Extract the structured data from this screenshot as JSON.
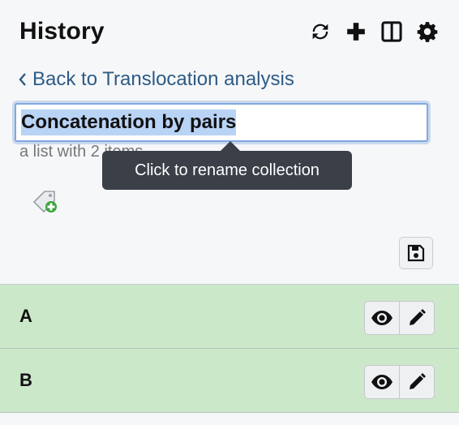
{
  "header": {
    "title": "History"
  },
  "back_link": {
    "label": "Back to Translocation analysis"
  },
  "collection": {
    "name": "Concatenation by pairs",
    "subtitle": "a list with 2 items",
    "tooltip": "Click to rename collection"
  },
  "items": [
    {
      "label": "A"
    },
    {
      "label": "B"
    }
  ],
  "colors": {
    "row_bg": "#cbe8c9",
    "link": "#2d5b85",
    "tooltip_bg": "#3a3f48"
  }
}
